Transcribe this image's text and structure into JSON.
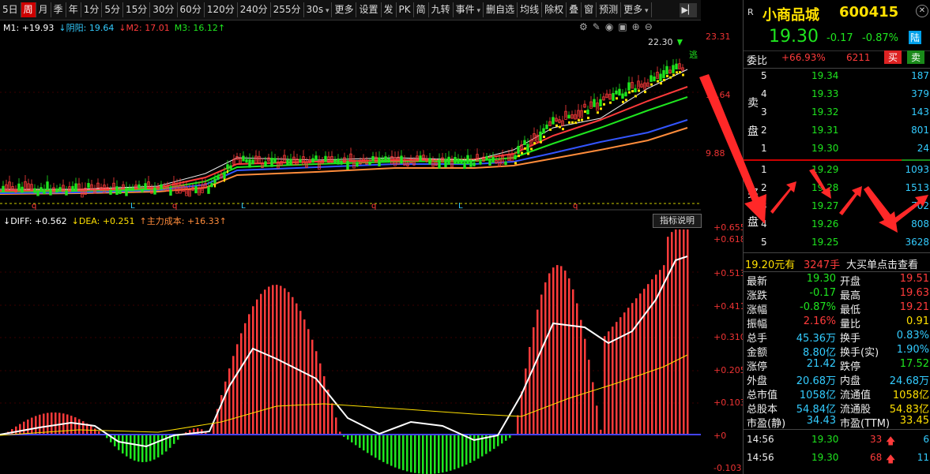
{
  "toolbar": {
    "items": [
      {
        "label": "5日"
      },
      {
        "label": "周",
        "active": true
      },
      {
        "label": "月"
      },
      {
        "label": "季"
      },
      {
        "label": "年"
      },
      {
        "label": "1分"
      },
      {
        "label": "5分"
      },
      {
        "label": "15分"
      },
      {
        "label": "30分"
      },
      {
        "label": "60分"
      },
      {
        "label": "120分"
      },
      {
        "label": "240分"
      },
      {
        "label": "255分"
      },
      {
        "label": "30s",
        "dropdown": true
      },
      {
        "label": "更多"
      },
      {
        "label": "设置"
      },
      {
        "label": "发"
      },
      {
        "label": "PK"
      },
      {
        "label": "简"
      },
      {
        "label": "九转"
      },
      {
        "label": "事件",
        "dropdown": true
      },
      {
        "label": "删自选"
      },
      {
        "label": "均线"
      },
      {
        "label": "除权"
      },
      {
        "label": "叠"
      },
      {
        "label": "窗"
      },
      {
        "label": "预测"
      },
      {
        "label": "更多",
        "dropdown": true
      }
    ]
  },
  "price_chart": {
    "legend": [
      {
        "text": "M1: +19.93",
        "color": "#ffffff"
      },
      {
        "text": "↓阴阳: 19.64",
        "color": "#3cf"
      },
      {
        "text": "↓M2: 17.01",
        "color": "#ff3b3b"
      },
      {
        "text": "M3: 16.12↑",
        "color": "#1fe61f"
      }
    ],
    "axis": [
      "23.31",
      "15.64",
      "9.88"
    ],
    "high_label": "22.30",
    "signal_label": "逃",
    "marker_labels": [
      "q",
      "L",
      "q",
      "L",
      "q",
      "L",
      "q"
    ]
  },
  "macd_chart": {
    "legend": [
      {
        "text": "↓DIFF: +0.562",
        "color": "#ffffff"
      },
      {
        "text": "↓DEA: +0.251",
        "color": "#ffe000"
      },
      {
        "text": "↑主力成本: +16.33↑",
        "color": "#ff8c3b"
      }
    ],
    "indicator_button": "指标说明",
    "axis": [
      "+0.655",
      "+0.618",
      "+0.513",
      "+0.411",
      "+0.310",
      "+0.205",
      "+0.103",
      "+0",
      "-0.103"
    ]
  },
  "quote": {
    "badge": "R",
    "name": "小商品城",
    "code": "600415",
    "price": "19.30",
    "change": "-0.17",
    "change_pct": "-0.87%",
    "exchange": "陆",
    "weibi_label": "委比",
    "weibi": "+66.93%",
    "weicha": "6211",
    "buy_btn": "买",
    "sell_btn": "卖",
    "sell_label": "卖盘",
    "buy_label": "买盘",
    "asks": [
      {
        "lvl": "5",
        "price": "19.34",
        "vol": "187"
      },
      {
        "lvl": "4",
        "price": "19.33",
        "vol": "379"
      },
      {
        "lvl": "3",
        "price": "19.32",
        "vol": "143"
      },
      {
        "lvl": "2",
        "price": "19.31",
        "vol": "801"
      },
      {
        "lvl": "1",
        "price": "19.30",
        "vol": "24"
      }
    ],
    "bids": [
      {
        "lvl": "1",
        "price": "19.29",
        "vol": "1093"
      },
      {
        "lvl": "2",
        "price": "19.28",
        "vol": "1513"
      },
      {
        "lvl": "3",
        "price": "19.27",
        "vol": "702"
      },
      {
        "lvl": "4",
        "price": "19.26",
        "vol": "808"
      },
      {
        "lvl": "5",
        "price": "19.25",
        "vol": "3628"
      }
    ],
    "big_order": {
      "price": "19.20元有",
      "vol": "3247手",
      "tip": "大买单点击查看"
    },
    "stats": [
      [
        "最新",
        "19.30",
        "开盘",
        "19.51"
      ],
      [
        "涨跌",
        "-0.17",
        "最高",
        "19.63"
      ],
      [
        "涨幅",
        "-0.87%",
        "最低",
        "19.21"
      ],
      [
        "振幅",
        "2.16%",
        "量比",
        "0.91"
      ],
      [
        "总手",
        "45.36万",
        "换手",
        "0.83%"
      ],
      [
        "金额",
        "8.80亿",
        "换手(实)",
        "1.90%"
      ],
      [
        "涨停",
        "21.42",
        "跌停",
        "17.52"
      ],
      [
        "外盘",
        "20.68万",
        "内盘",
        "24.68万"
      ],
      [
        "总市值",
        "1058亿",
        "流通值",
        "1058亿"
      ],
      [
        "总股本",
        "54.84亿",
        "流通股",
        "54.83亿"
      ],
      [
        "市盈(静)",
        "34.43",
        "市盈(TTM)",
        "33.45"
      ]
    ],
    "ticks": [
      {
        "time": "14:56",
        "price": "19.30",
        "vol": "33",
        "n": "6"
      },
      {
        "time": "14:56",
        "price": "19.30",
        "vol": "68",
        "n": "11"
      }
    ]
  }
}
